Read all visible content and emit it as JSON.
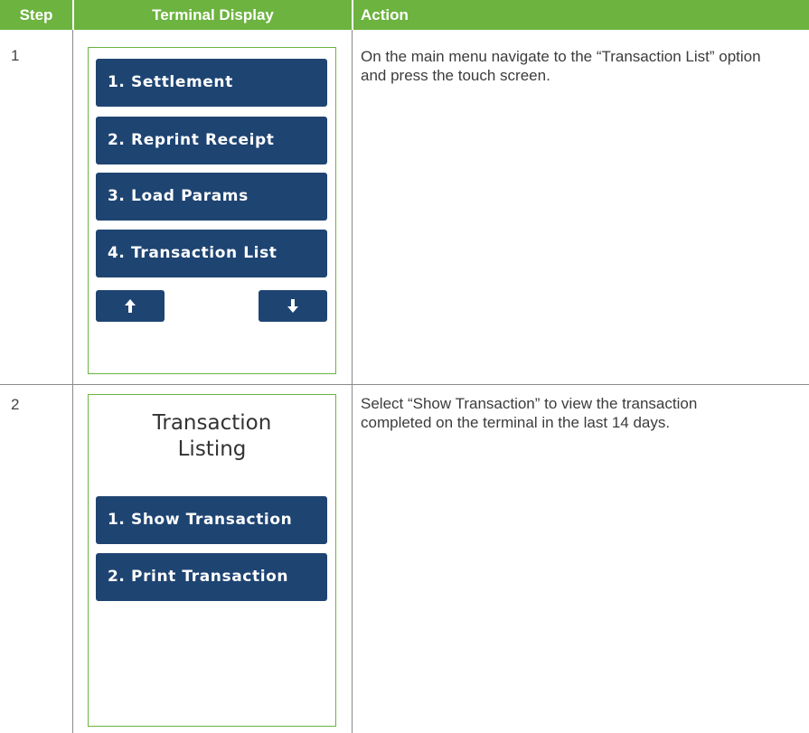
{
  "header": {
    "step": "Step",
    "terminal_display": "Terminal Display",
    "action": "Action"
  },
  "rows": [
    {
      "step": "1",
      "screen": {
        "buttons": [
          "1. Settlement",
          "2. Reprint Receipt",
          "3. Load Params",
          "4. Transaction List"
        ],
        "up_icon": "arrow-up-icon",
        "down_icon": "arrow-down-icon"
      },
      "action": "On the main menu navigate to the “Transaction List” option and press the touch screen."
    },
    {
      "step": "2",
      "screen": {
        "title_line1": "Transaction",
        "title_line2": "Listing",
        "buttons": [
          "1. Show Transaction",
          "2. Print Transaction"
        ]
      },
      "action": "Select “Show Transaction” to view the transaction completed on the terminal in the last 14 days."
    }
  ],
  "colors": {
    "header_green": "#6cb33f",
    "button_navy": "#1e4472",
    "screen_border": "#6cb33f"
  }
}
